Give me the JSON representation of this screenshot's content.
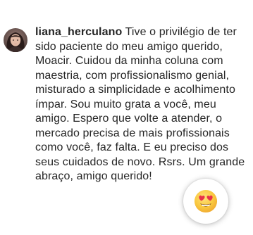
{
  "comment": {
    "username": "liana_herculano",
    "text": "Tive o privilégio de ter sido paciente do meu amigo querido, Moacir. Cuidou da minha coluna com maestria, com profissionalismo genial, misturado a simplicidade e acolhimento ímpar. Sou muito grata a você, meu amigo. Espero que volte a atender, o mercado precisa de mais profissionais como você, faz falta. E eu preciso dos seus cuidados de novo. Rsrs. Um grande abraço, amigo querido!"
  },
  "avatar": {
    "icon": "user-avatar-photo"
  },
  "reaction": {
    "icon": "heart-eyes-emoji-icon",
    "emoji": "😍"
  },
  "colors": {
    "background": "#ffffff",
    "text": "#262626",
    "emoji_face": "#f7c641",
    "emoji_hearts": "#e8324a"
  }
}
